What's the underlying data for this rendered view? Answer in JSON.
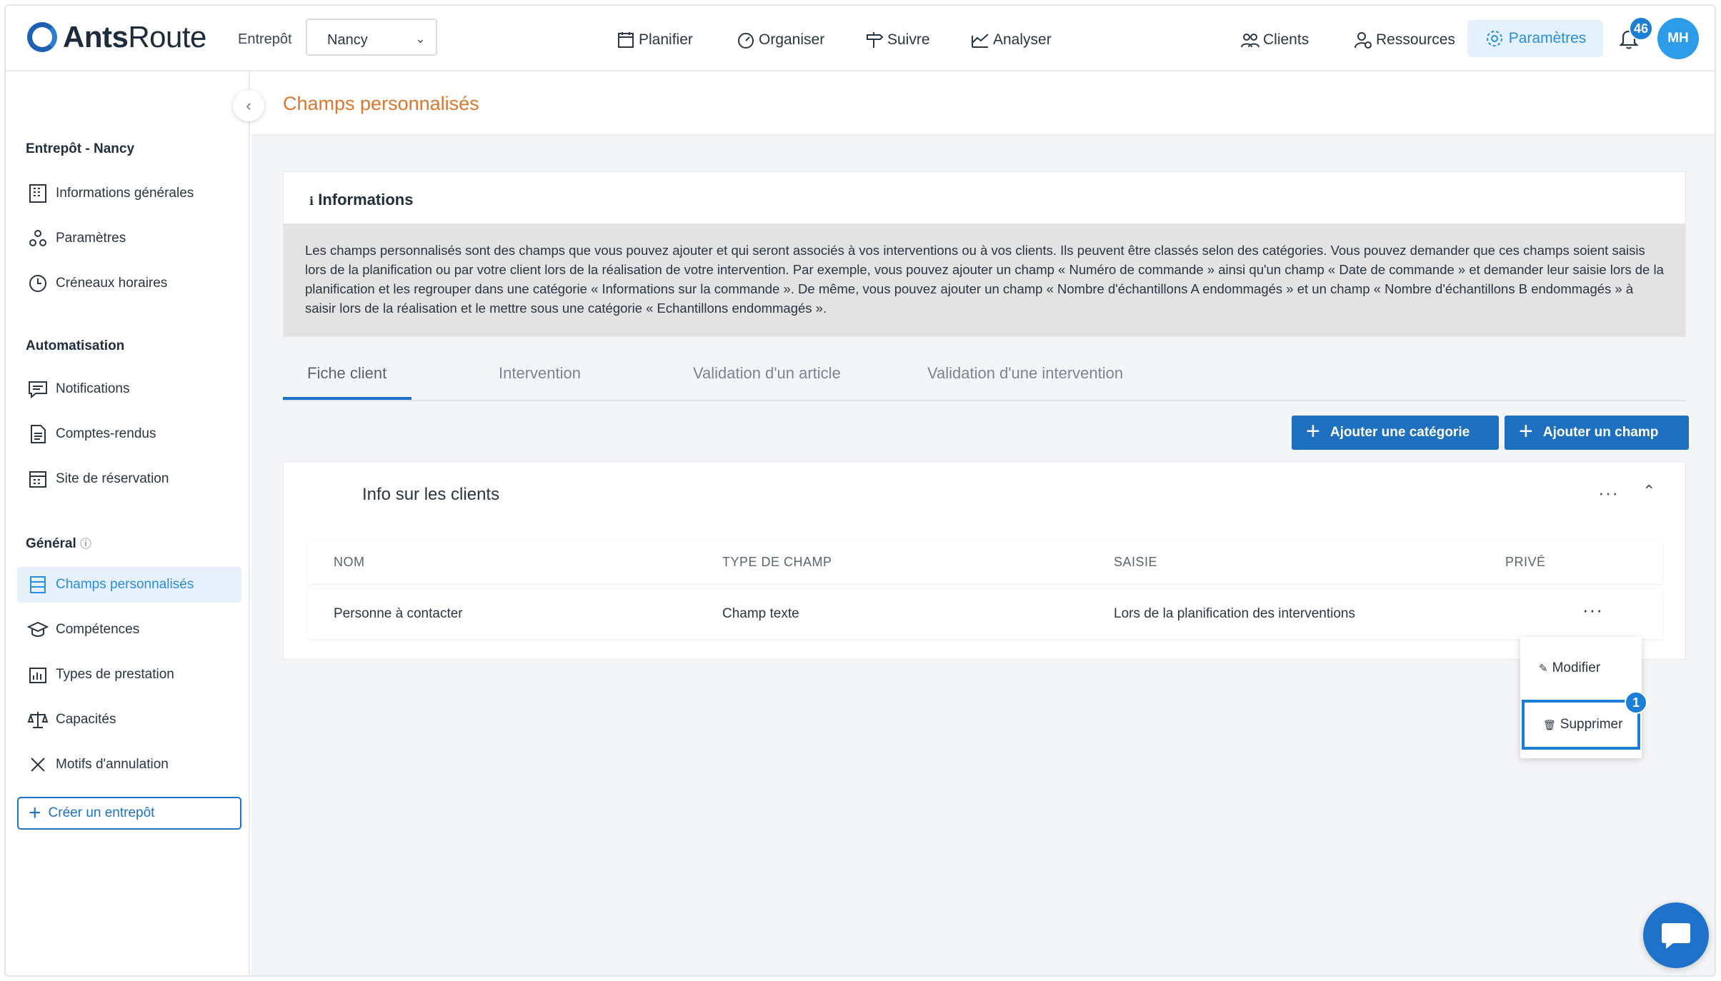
{
  "app": {
    "logo_text_bold": "Ants",
    "logo_text": "Route"
  },
  "header": {
    "warehouse_label": "Entrepôt",
    "warehouse_value": "Nancy",
    "nav": [
      "Planifier",
      "Organiser",
      "Suivre",
      "Analyser"
    ],
    "right_nav": [
      "Clients",
      "Ressources",
      "Paramètres"
    ],
    "notifications_count": "46",
    "avatar_initials": "MH",
    "accent_color": "#2a8ee0"
  },
  "sidebar": {
    "section1": "Entrepôt - Nancy",
    "items1": [
      "Informations générales",
      "Paramètres",
      "Créneaux horaires"
    ],
    "section2": "Automatisation",
    "items2": [
      "Notifications",
      "Comptes-rendus",
      "Site de réservation"
    ],
    "section3": "Général",
    "items3": [
      "Champs personnalisés",
      "Compétences",
      "Types de prestation",
      "Capacités",
      "Motifs d'annulation"
    ],
    "create_button": "Créer un entrepôt"
  },
  "main": {
    "page_title": "Champs personnalisés",
    "info_title": "Informations",
    "info_text": "Les champs personnalisés sont des champs que vous pouvez ajouter et qui seront associés à vos interventions ou à vos clients. Ils peuvent être classés selon des catégories. Vous pouvez demander que ces champs soient saisis lors de la planification ou par votre client lors de la réalisation de votre intervention. Par exemple, vous pouvez ajouter un champ « Numéro de commande » ainsi qu'un champ « Date de commande » et demander leur saisie lors de la planification et les regrouper dans une catégorie « Informations sur la commande ». De même, vous pouvez ajouter un champ « Nombre d'échantillons A endommagés » et un champ « Nombre d'échantillons B endommagés » à saisir lors de la réalisation et le mettre sous une catégorie « Echantillons endommagés ».",
    "tabs": [
      "Fiche client",
      "Intervention",
      "Validation d'un article",
      "Validation d'une intervention"
    ],
    "add_category": "Ajouter une catégorie",
    "add_field": "Ajouter un champ",
    "category_title": "Info sur les clients",
    "columns": [
      "NOM",
      "TYPE DE CHAMP",
      "SAISIE",
      "PRIVÉ"
    ],
    "rows": [
      {
        "name": "Personne à contacter",
        "type": "Champ texte",
        "input": "Lors de la planification des interventions",
        "private": ""
      }
    ],
    "menu": {
      "edit": "Modifier",
      "delete": "Supprimer",
      "step": "1"
    }
  }
}
